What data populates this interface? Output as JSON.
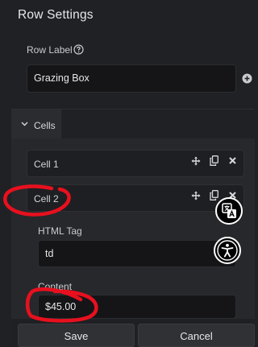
{
  "panel": {
    "title": "Row Settings"
  },
  "row_label": {
    "label": "Row Label",
    "value": "Grazing Box"
  },
  "cells_section": {
    "label": "Cells"
  },
  "cells": [
    {
      "label": "Cell 1"
    },
    {
      "label": "Cell 2"
    }
  ],
  "cell_fields": {
    "html_tag_label": "HTML Tag",
    "html_tag_value": "td",
    "content_label": "Content",
    "content_value": "$45.00"
  },
  "footer": {
    "save_label": "Save",
    "cancel_label": "Cancel"
  },
  "icons": {
    "help": "help-circle-icon",
    "add": "plus-circle-icon",
    "chevron": "chevron-down-icon",
    "move": "move-icon",
    "duplicate": "duplicate-icon",
    "remove": "close-icon",
    "translate": "translate-icon",
    "accessibility": "accessibility-icon"
  },
  "colors": {
    "background": "#202124",
    "panel": "#27282b",
    "input_background": "#151517",
    "annotation": "#e8101e"
  }
}
